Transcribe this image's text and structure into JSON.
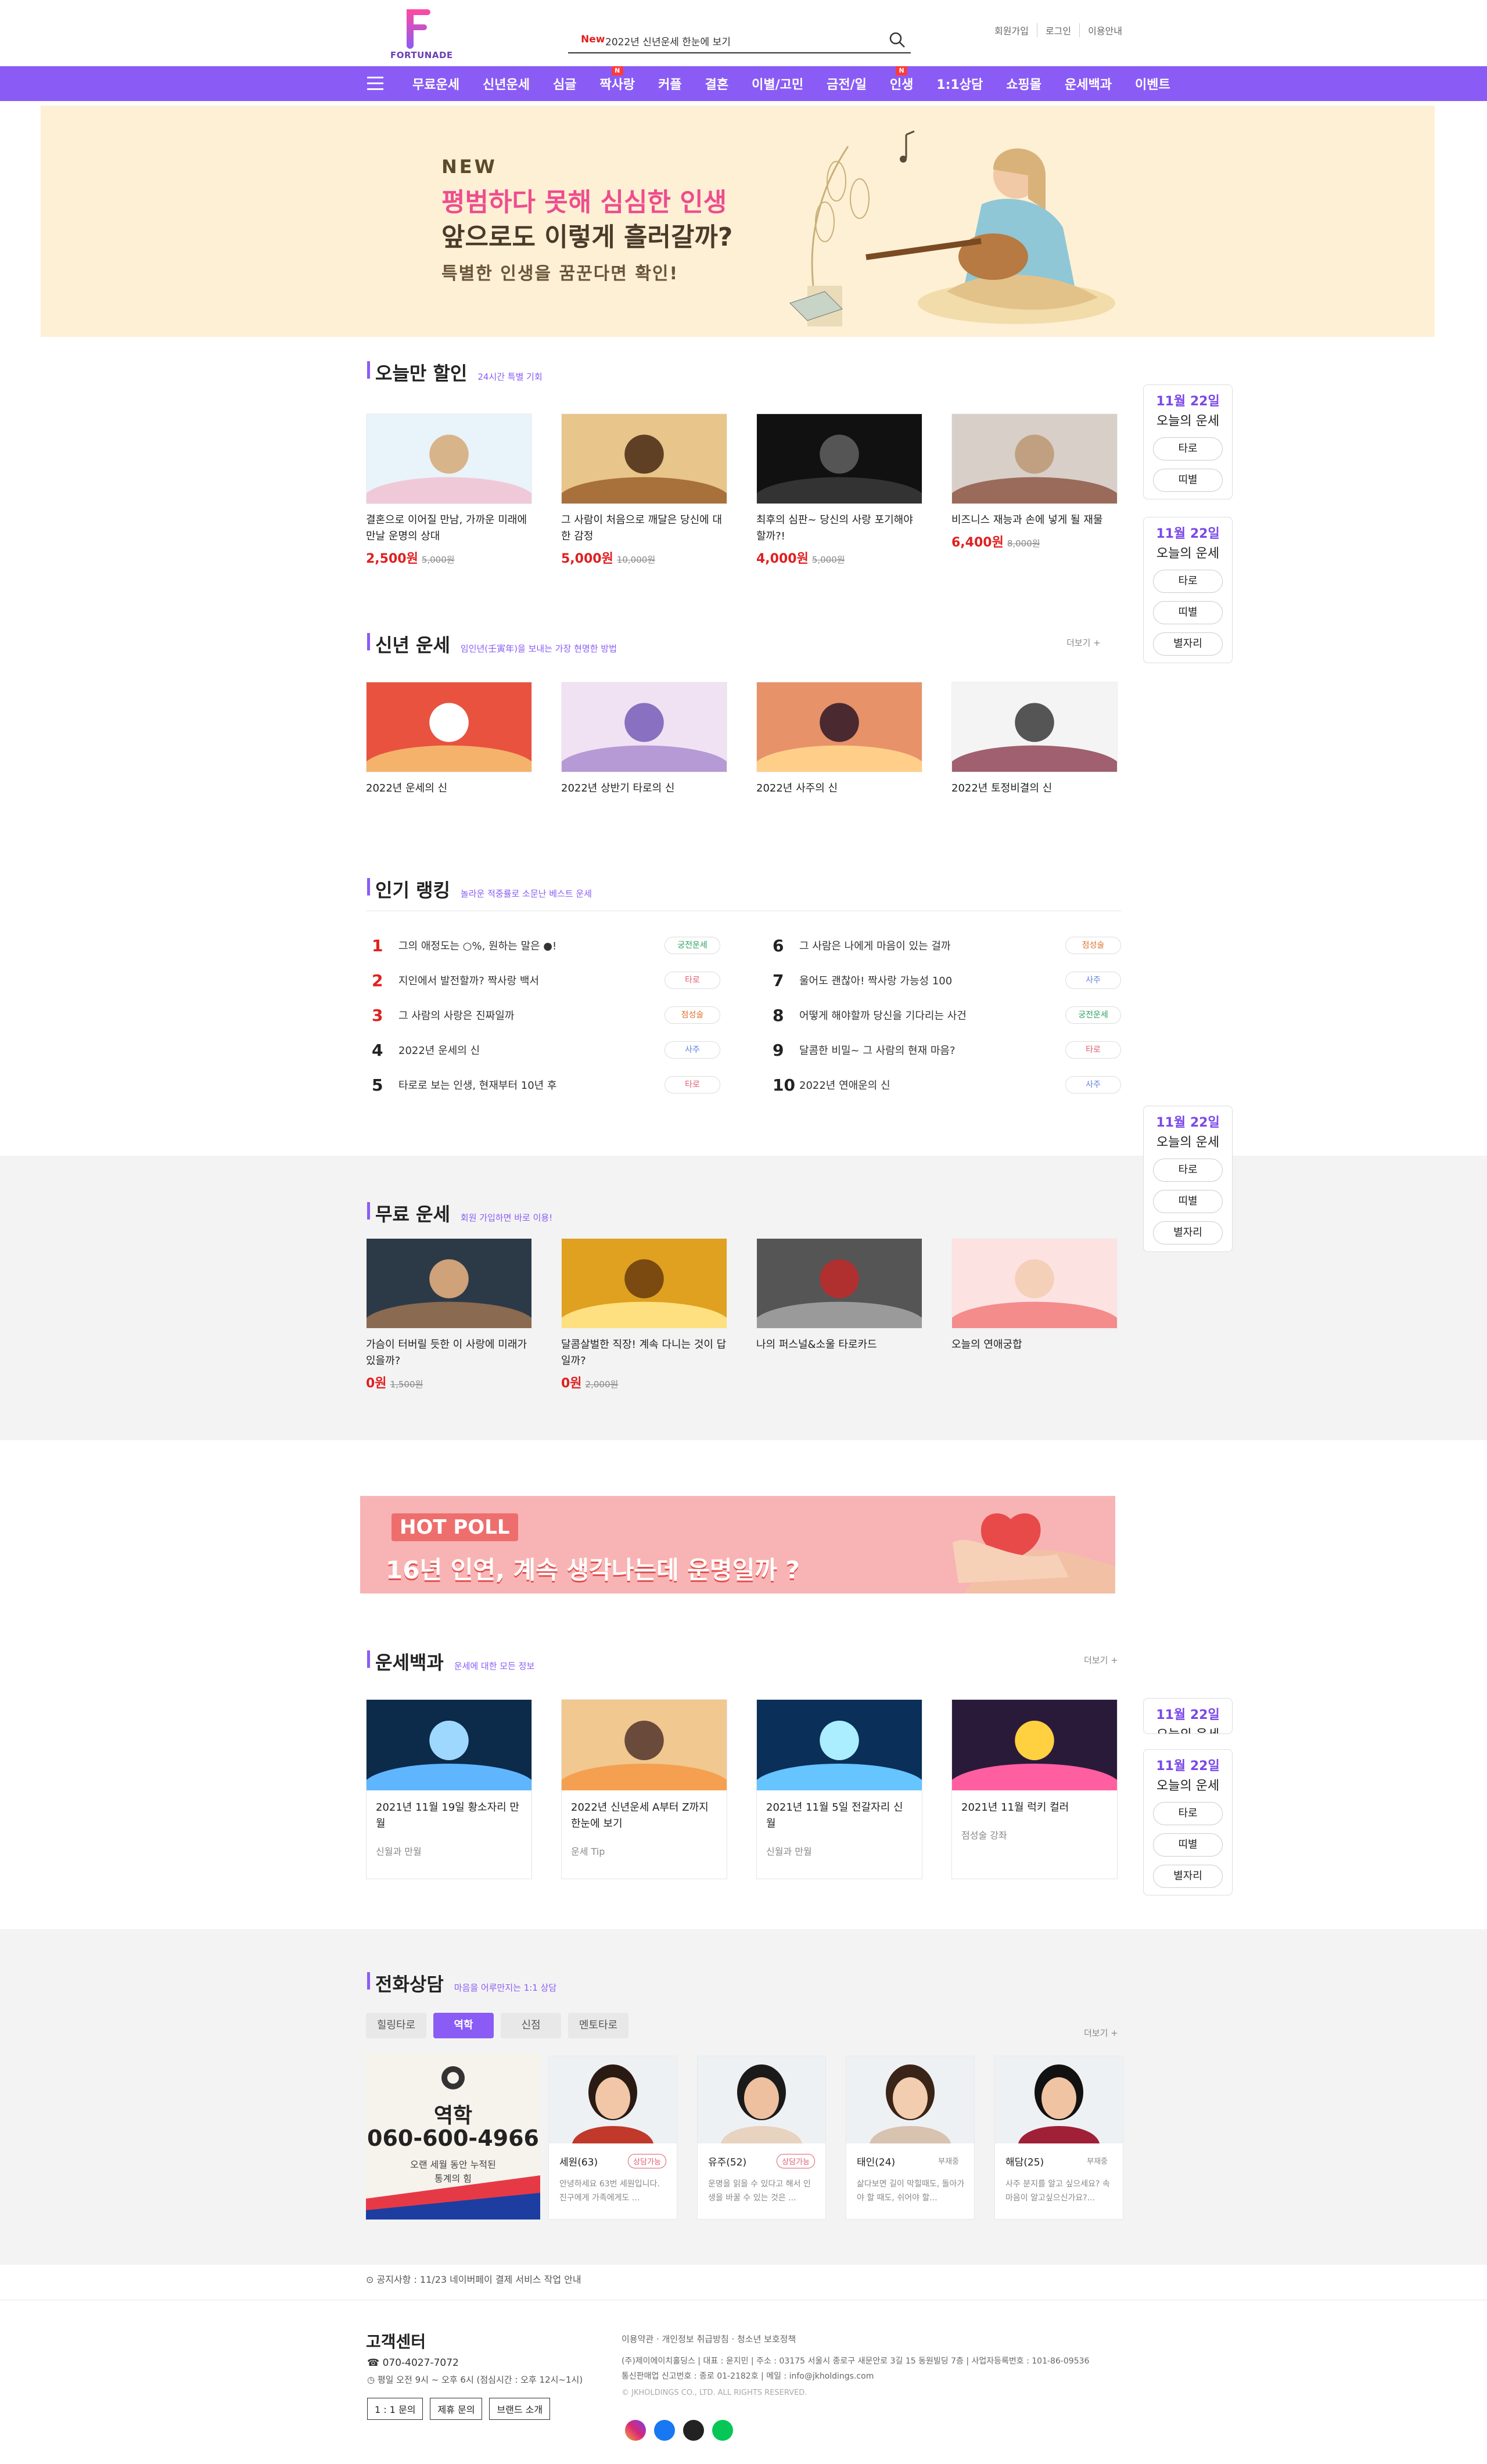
{
  "header": {
    "logo_text": "FORTUNADE",
    "search_new": "New",
    "search_text": "2022년 신년운세 한눈에 보기",
    "top_links": [
      "회원가입",
      "로그인",
      "이용안내"
    ]
  },
  "nav": {
    "items": [
      {
        "label": "무료운세",
        "badge": ""
      },
      {
        "label": "신년운세",
        "badge": ""
      },
      {
        "label": "심글",
        "badge": ""
      },
      {
        "label": "짝사랑",
        "badge": "N"
      },
      {
        "label": "커플",
        "badge": ""
      },
      {
        "label": "결혼",
        "badge": ""
      },
      {
        "label": "이별/고민",
        "badge": ""
      },
      {
        "label": "금전/일",
        "badge": ""
      },
      {
        "label": "인생",
        "badge": "N"
      },
      {
        "label": "1:1상담",
        "badge": ""
      },
      {
        "label": "쇼핑몰",
        "badge": ""
      },
      {
        "label": "운세백과",
        "badge": ""
      },
      {
        "label": "이벤트",
        "badge": ""
      }
    ]
  },
  "hero": {
    "new": "NEW",
    "line1": "평범하다 못해 심심한 인생",
    "line2": "앞으로도 이렇게 흘러갈까?",
    "line3": "특별한 인생을 꿈꾼다면 확인!"
  },
  "today_sale": {
    "title": "오늘만 할인",
    "sub": "24시간 특별 기회",
    "items": [
      {
        "title": "결혼으로 이어질 만남, 가까운 미래에 만날 운명의 상대",
        "price": "2,500원",
        "orig": "5,000원"
      },
      {
        "title": "그 사람이 처음으로 깨달은 당신에 대한 감정",
        "price": "5,000원",
        "orig": "10,000원"
      },
      {
        "title": "최후의 심판~ 당신의 사랑 포기해야 할까?!",
        "price": "4,000원",
        "orig": "5,000원"
      },
      {
        "title": "비즈니스 재능과 손에 넣게 될 재물",
        "price": "6,400원",
        "orig": "8,000원"
      }
    ]
  },
  "newyear": {
    "title": "신년 운세",
    "sub": "임인년(壬寅年)을 보내는 가장 현명한 방법",
    "more": "더보기 +",
    "items": [
      "2022년 운세의 신",
      "2022년 상반기 타로의 신",
      "2022년 사주의 신",
      "2022년 토정비결의 신"
    ]
  },
  "ranking": {
    "title": "인기 랭킹",
    "sub": "놀라운 적중률로 소문난 베스트 운세",
    "left": [
      {
        "num": "1",
        "text": "그의 애정도는 ○%, 원하는 말은 ●!",
        "tag": "궁전운세"
      },
      {
        "num": "2",
        "text": "지인에서 발전할까? 짝사랑 백서",
        "tag": "타로"
      },
      {
        "num": "3",
        "text": "그 사람의 사랑은 진짜일까",
        "tag": "점성술"
      },
      {
        "num": "4",
        "text": "2022년 운세의 신",
        "tag": "사주"
      },
      {
        "num": "5",
        "text": "타로로 보는 인생, 현재부터 10년 후",
        "tag": "타로"
      }
    ],
    "right": [
      {
        "num": "6",
        "text": "그 사람은 나에게 마음이 있는 걸까",
        "tag": "점성술"
      },
      {
        "num": "7",
        "text": "울어도 괜찮아! 짝사랑 가능성 100",
        "tag": "사주"
      },
      {
        "num": "8",
        "text": "어떻게 해야할까 당신을 기다리는 사건",
        "tag": "궁전운세"
      },
      {
        "num": "9",
        "text": "달콤한 비밀~ 그 사람의 현재 마음?",
        "tag": "타로"
      },
      {
        "num": "10",
        "text": "2022년 연애운의 신",
        "tag": "사주"
      }
    ]
  },
  "free": {
    "title": "무료 운세",
    "sub": "회원 가입하면 바로 이용!",
    "items": [
      {
        "title": "가슴이 터버릴 듯한 이 사랑에 미래가 있을까?",
        "price": "0원",
        "orig": "1,500원"
      },
      {
        "title": "달콤살벌한 직장! 계속 다니는 것이 답일까?",
        "price": "0원",
        "orig": "2,000원"
      },
      {
        "title": "나의 퍼스널&소울 타로카드",
        "price": "",
        "orig": ""
      },
      {
        "title": "오늘의 연애궁합",
        "price": "",
        "orig": ""
      }
    ]
  },
  "poll": {
    "hot": "HOT POLL",
    "text": "16년 인연, 계속 생각나는데 운명일까 ?"
  },
  "encyclopedia": {
    "title": "운세백과",
    "sub": "운세에 대한 모든 정보",
    "more": "더보기 +",
    "items": [
      {
        "title": "2021년 11월 19일 황소자리 만월",
        "cat": "신월과 만월"
      },
      {
        "title": "2022년 신년운세 A부터 Z까지 한눈에 보기",
        "cat": "운세 Tip"
      },
      {
        "title": "2021년 11월 5일 전갈자리 신월",
        "cat": "신월과 만월"
      },
      {
        "title": "2021년 11월 럭키 컬러",
        "cat": "점성술 강좌"
      }
    ]
  },
  "side": {
    "date": "11월 22일",
    "label": "오늘의 운세",
    "btns": [
      "타로",
      "띠별",
      "별자리"
    ]
  },
  "phone": {
    "title": "전화상담",
    "sub": "마음을 어루만지는 1:1 상담",
    "more": "더보기 +",
    "tabs": [
      "힐링타로",
      "역학",
      "신점",
      "멘토타로"
    ],
    "banner_title": "역학",
    "banner_phone": "060-600-4966",
    "banner_l1": "오랜 세월 동안 누적된",
    "banner_l2": "통계의 힘",
    "counselors": [
      {
        "name": "세원(63)",
        "status": "상담가능",
        "desc": "안녕하세요 63번 세원입니다. 진구에게 가족에게도 ..."
      },
      {
        "name": "유주(52)",
        "status": "상담가능",
        "desc": "운명을 읽을 수 있다고 해서 인생을 바꿀 수 있는 것은 ..."
      },
      {
        "name": "태인(24)",
        "status": "부재중",
        "desc": "삶다보면 길이 막힐때도, 돌아가야 할 때도, 쉬어야 할..."
      },
      {
        "name": "해담(25)",
        "status": "부재중",
        "desc": "사주 분지를 알고 싶으세요? 속 마음이 알고싶으신가요?..."
      }
    ]
  },
  "notice": "공지사항 : 11/23 네이버페이 결제 서비스 작업 안내",
  "footer": {
    "title": "고객센터",
    "tel": "070-4027-7072",
    "hours": "평일 오전 9시 ~ 오후 6시 (점심시간 : 오후 12시~1시)",
    "btns": [
      "1 : 1 문의",
      "제휴 문의",
      "브랜드 소개"
    ],
    "links": "이용약관 · 개인정보 취급방침 · 청소년 보호정책",
    "info1": "(주)제이에이치홀딩스 | 대표 : 윤지민 | 주소 : 03175 서울시 종로구 새문안로 3길 15 동원빌딩 7층 | 사업자등록번호 : 101-86-09536",
    "info2": "통신판매업 신고번호 : 종로 01-2182호 | 메일 : info@jkholdings.com",
    "copy": "© JKHOLDINGS CO., LTD. ALL RIGHTS RESERVED."
  },
  "colors": {
    "accent": "#8a5cf5",
    "red": "#e02020",
    "hero_bg": "#fdf0d5",
    "poll_bg": "#f8b4b4"
  }
}
